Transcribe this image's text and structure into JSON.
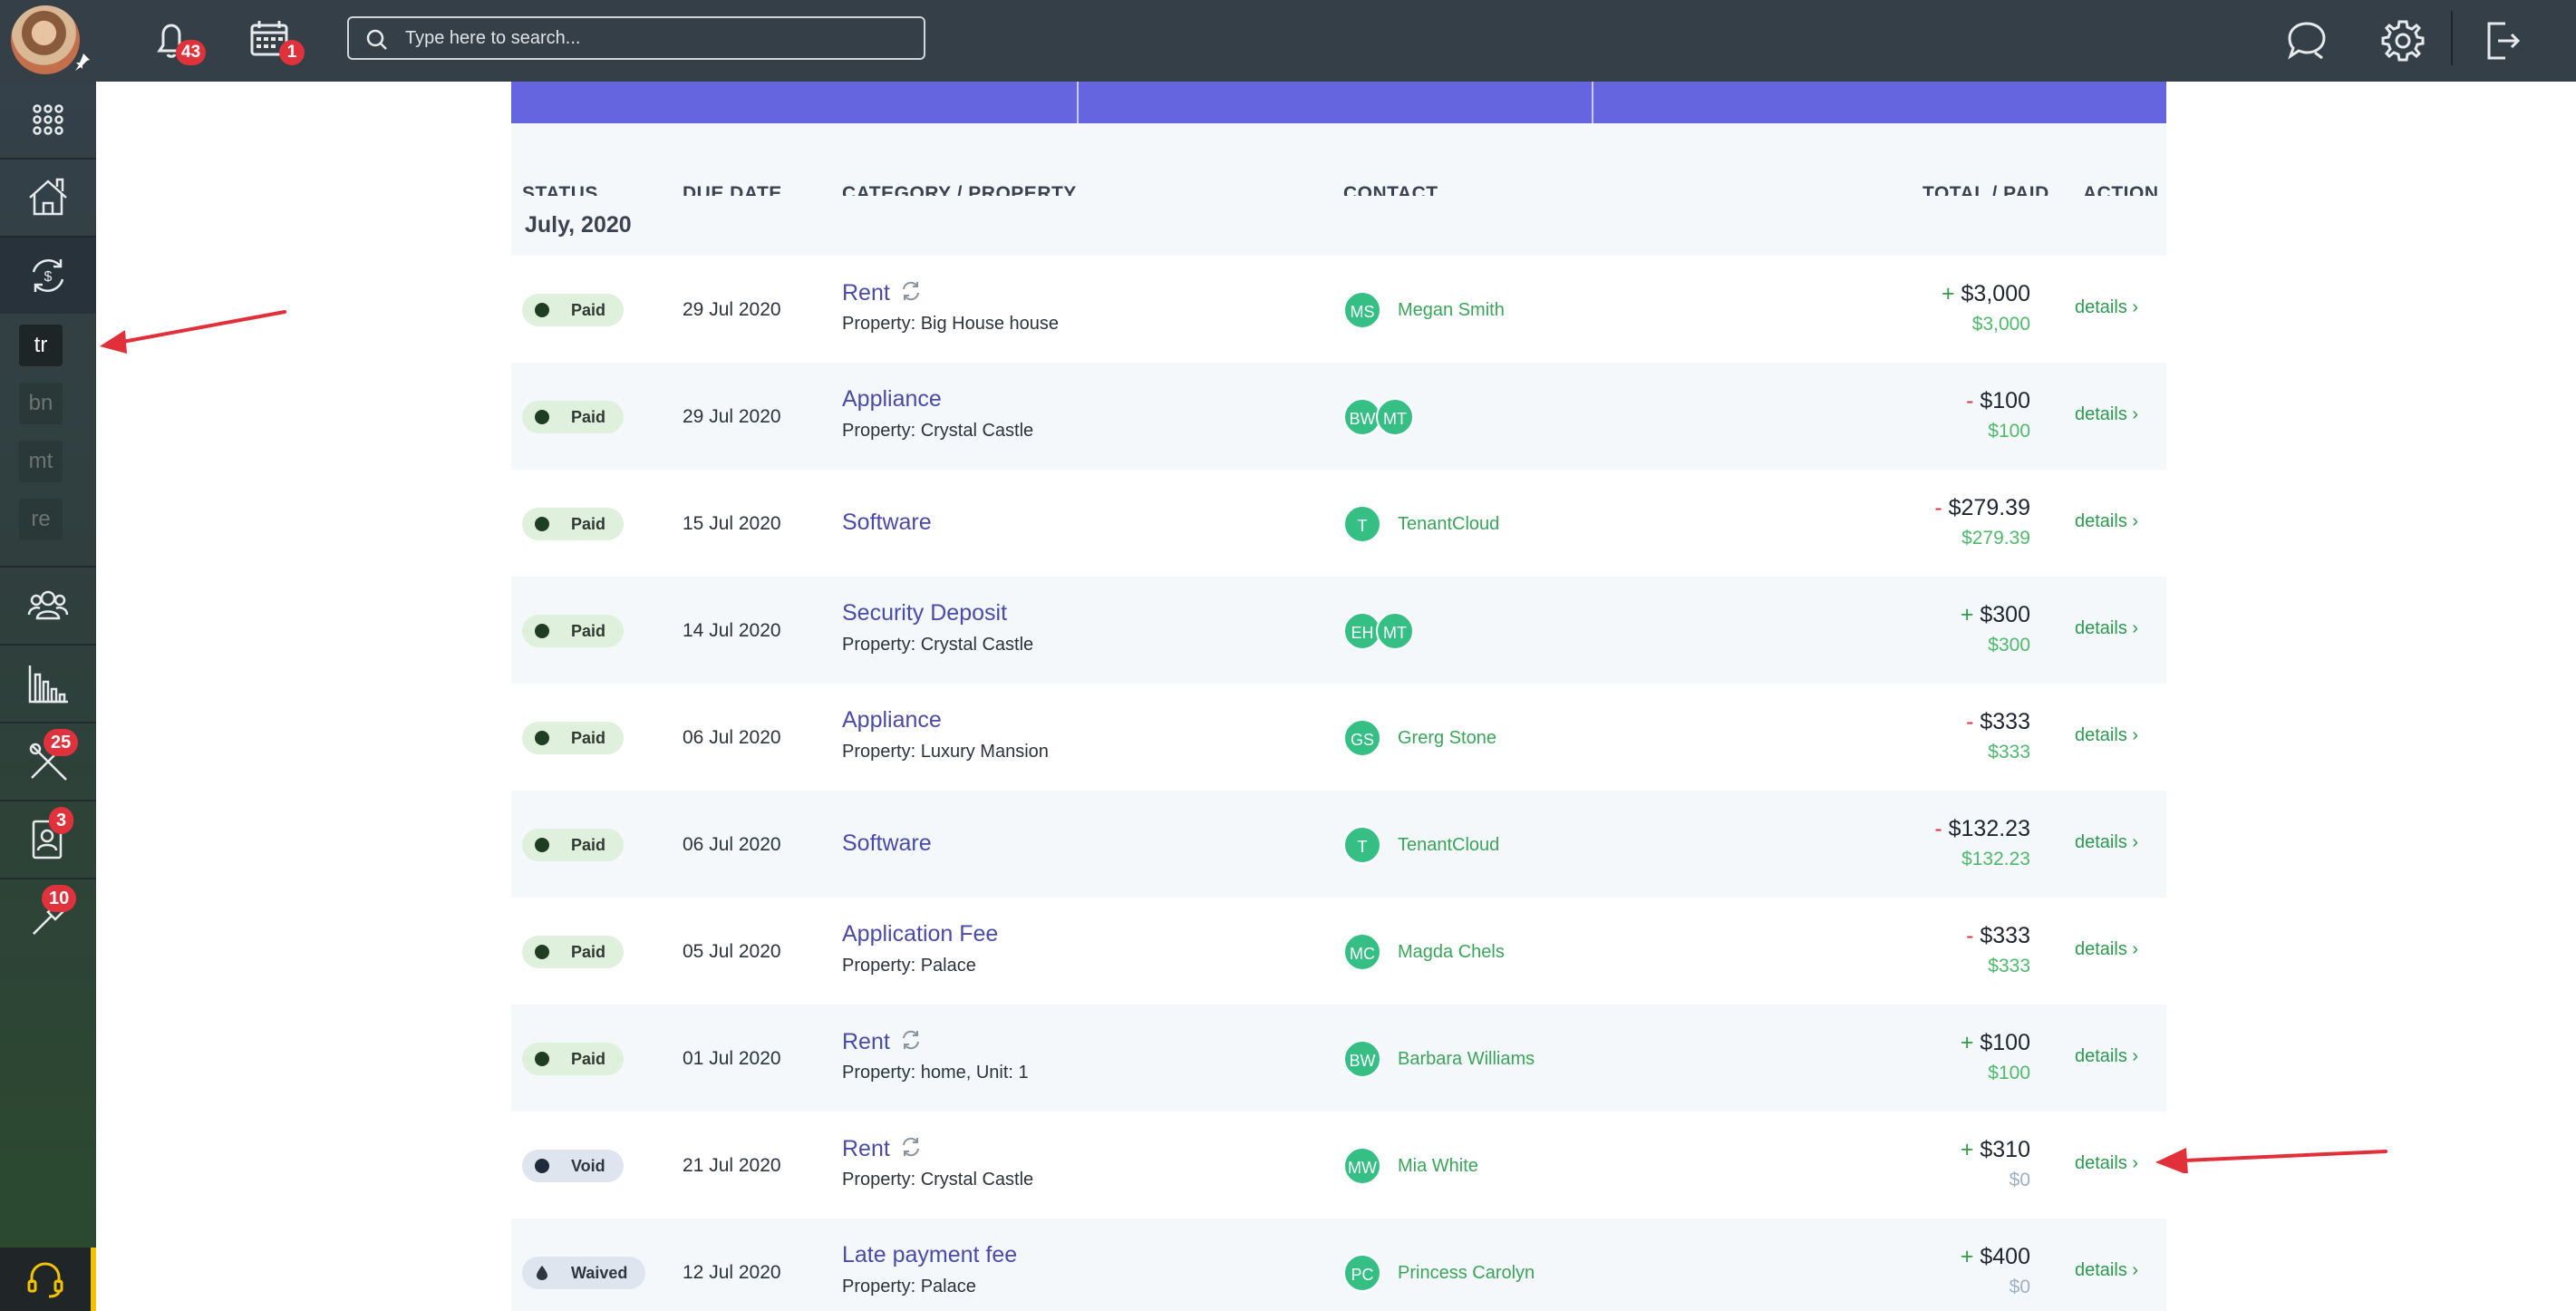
{
  "header": {
    "notifications_count": "43",
    "calendar_count": "1",
    "search_placeholder": "Type here to search..."
  },
  "sidebar": {
    "sub_items": [
      "tr",
      "bn",
      "mt",
      "re"
    ],
    "maintenance_badge": "25",
    "contacts_badge": "3",
    "tools_badge": "10"
  },
  "table": {
    "columns": {
      "status": "STATUS",
      "due_date": "DUE DATE",
      "category": "CATEGORY / PROPERTY",
      "contact": "CONTACT",
      "total": "TOTAL / PAID",
      "action": "ACTION"
    },
    "month_label": "July, 2020",
    "rows": [
      {
        "status": "Paid",
        "date": "29 Jul 2020",
        "category": "Rent",
        "property": "Property: Big House house",
        "avatars": [
          "MS"
        ],
        "contact": "Megan Smith",
        "sign": "+",
        "total": "$3,000",
        "paid": "$3,000",
        "action": "details"
      },
      {
        "status": "Paid",
        "date": "29 Jul 2020",
        "category": "Appliance",
        "property": "Property: Crystal Castle",
        "avatars": [
          "BW",
          "MT"
        ],
        "contact": "",
        "sign": "-",
        "total": "$100",
        "paid": "$100",
        "action": "details"
      },
      {
        "status": "Paid",
        "date": "15 Jul 2020",
        "category": "Software",
        "property": "",
        "avatars": [
          "T"
        ],
        "contact": "TenantCloud",
        "sign": "-",
        "total": "$279.39",
        "paid": "$279.39",
        "action": "details"
      },
      {
        "status": "Paid",
        "date": "14 Jul 2020",
        "category": "Security Deposit",
        "property": "Property: Crystal Castle",
        "avatars": [
          "EH",
          "MT"
        ],
        "contact": "",
        "sign": "+",
        "total": "$300",
        "paid": "$300",
        "action": "details"
      },
      {
        "status": "Paid",
        "date": "06 Jul 2020",
        "category": "Appliance",
        "property": "Property: Luxury Mansion",
        "avatars": [
          "GS"
        ],
        "contact": "Grerg Stone",
        "sign": "-",
        "total": "$333",
        "paid": "$333",
        "action": "details"
      },
      {
        "status": "Paid",
        "date": "06 Jul 2020",
        "category": "Software",
        "property": "",
        "avatars": [
          "T"
        ],
        "contact": "TenantCloud",
        "sign": "-",
        "total": "$132.23",
        "paid": "$132.23",
        "action": "details"
      },
      {
        "status": "Paid",
        "date": "05 Jul 2020",
        "category": "Application Fee",
        "property": "Property: Palace",
        "avatars": [
          "MC"
        ],
        "contact": "Magda Chels",
        "sign": "-",
        "total": "$333",
        "paid": "$333",
        "action": "details"
      },
      {
        "status": "Paid",
        "date": "01 Jul 2020",
        "category": "Rent",
        "property": "Property: home, Unit: 1",
        "avatars": [
          "BW"
        ],
        "contact": "Barbara Williams",
        "sign": "+",
        "total": "$100",
        "paid": "$100",
        "action": "details"
      },
      {
        "status": "Void",
        "date": "21 Jul 2020",
        "category": "Rent",
        "property": "Property: Crystal Castle",
        "avatars": [
          "MW"
        ],
        "contact": "Mia White",
        "sign": "+",
        "total": "$310",
        "paid": "$0",
        "action": "details"
      },
      {
        "status": "Waived",
        "date": "12 Jul 2020",
        "category": "Late payment fee",
        "property": "Property: Palace",
        "avatars": [
          "PC"
        ],
        "contact": "Princess Carolyn",
        "sign": "+",
        "total": "$400",
        "paid": "$0",
        "action": "details"
      }
    ]
  },
  "colors": {
    "topbar": "#353f47",
    "banner": "#6565e0",
    "accent_green": "#35bf85",
    "category_link": "#4a4aa8",
    "annotation_arrow": "#e2303a"
  }
}
